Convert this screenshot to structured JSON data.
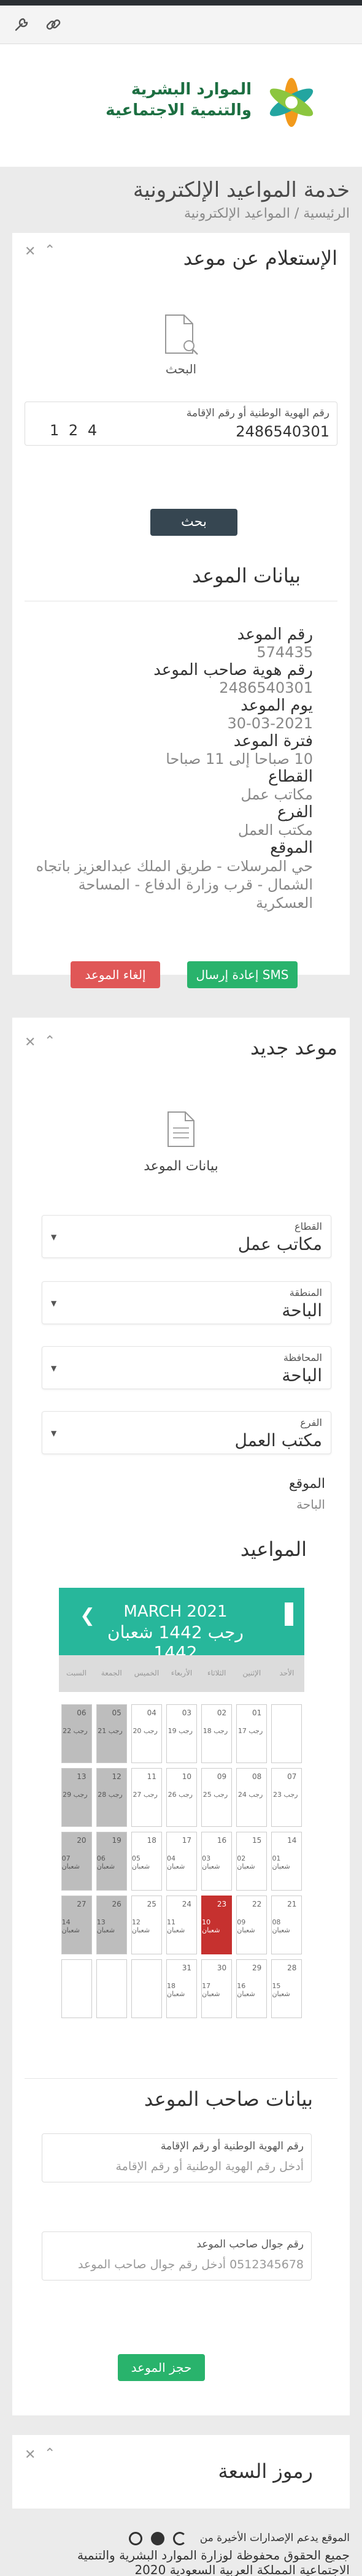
{
  "header": {
    "logo_line1": "الموارد البشرية",
    "logo_line2": "والتنمية الاجتماعية",
    "page_title": "خدمة المواعيد الإلكترونية",
    "breadcrumb": "الرئيسية / المواعيد الإلكترونية"
  },
  "inquiry": {
    "title": "الإستعلام عن موعد",
    "search_label": "البحث",
    "id_field_label": "رقم الهوية الوطنية أو رقم الإقامة",
    "id_field_value": "2486540301",
    "captcha": "4 2 1",
    "search_button": "بحث"
  },
  "appointment": {
    "title": "بيانات الموعد",
    "rows": [
      {
        "label": "رقم الموعد",
        "value": "574435"
      },
      {
        "label": "رقم هوية صاحب الموعد",
        "value": "2486540301"
      },
      {
        "label": "يوم الموعد",
        "value": "30-03-2021"
      },
      {
        "label": "فترة الموعد",
        "value": "10 صباحا إلى 11 صباحا"
      },
      {
        "label": "القطاع",
        "value": "مكاتب عمل"
      },
      {
        "label": "الفرع",
        "value": "مكتب العمل"
      },
      {
        "label": "الموقع",
        "value": "حي المرسلات - طريق الملك عبدالعزيز باتجاه الشمال - قرب وزارة الدفاع - المساحة العسكرية"
      }
    ],
    "cancel_button": "إلغاء الموعد",
    "resend_button": "إعادة إرسال SMS"
  },
  "new_appointment": {
    "title": "موعد جديد",
    "section_label": "بيانات الموعد",
    "selects": [
      {
        "label": "القطاع",
        "value": "مكاتب عمل"
      },
      {
        "label": "المنطقة",
        "value": "الباحة"
      },
      {
        "label": "المحافظة",
        "value": "الباحة"
      },
      {
        "label": "الفرع",
        "value": "مكتب العمل"
      }
    ],
    "location_label": "الموقع",
    "location_value": "الباحة",
    "schedule_title": "المواعيد"
  },
  "calendar": {
    "month_gregorian": "MARCH 2021",
    "month_hijri": "رجب 1442 شعبان 1442",
    "prev_symbol": "❮",
    "days_of_week": [
      "الأحد",
      "الإثنين",
      "الثلاثاء",
      "الأربعاء",
      "الخميس",
      "الجمعة",
      "السبت"
    ],
    "weeks": [
      [
        {
          "g": "",
          "h": "",
          "s": "empty"
        },
        {
          "g": "01",
          "h": "17 رجب",
          "s": "n"
        },
        {
          "g": "02",
          "h": "18 رجب",
          "s": "n"
        },
        {
          "g": "03",
          "h": "19 رجب",
          "s": "n"
        },
        {
          "g": "04",
          "h": "20 رجب",
          "s": "n"
        },
        {
          "g": "05",
          "h": "21 رجب",
          "s": "grey"
        },
        {
          "g": "06",
          "h": "22 رجب",
          "s": "grey"
        }
      ],
      [
        {
          "g": "07",
          "h": "23 رجب",
          "s": "n"
        },
        {
          "g": "08",
          "h": "24 رجب",
          "s": "n"
        },
        {
          "g": "09",
          "h": "25 رجب",
          "s": "n"
        },
        {
          "g": "10",
          "h": "26 رجب",
          "s": "n"
        },
        {
          "g": "11",
          "h": "27 رجب",
          "s": "n"
        },
        {
          "g": "12",
          "h": "28 رجب",
          "s": "grey"
        },
        {
          "g": "13",
          "h": "29 رجب",
          "s": "grey"
        }
      ],
      [
        {
          "g": "14",
          "h": "01 شعبان",
          "s": "n"
        },
        {
          "g": "15",
          "h": "02 شعبان",
          "s": "n"
        },
        {
          "g": "16",
          "h": "03 شعبان",
          "s": "n"
        },
        {
          "g": "17",
          "h": "04 شعبان",
          "s": "n"
        },
        {
          "g": "18",
          "h": "05 شعبان",
          "s": "n"
        },
        {
          "g": "19",
          "h": "06 شعبان",
          "s": "grey"
        },
        {
          "g": "20",
          "h": "07 شعبان",
          "s": "grey"
        }
      ],
      [
        {
          "g": "21",
          "h": "08 شعبان",
          "s": "n"
        },
        {
          "g": "22",
          "h": "09 شعبان",
          "s": "n"
        },
        {
          "g": "23",
          "h": "10 شعبان",
          "s": "sel"
        },
        {
          "g": "24",
          "h": "11 شعبان",
          "s": "n"
        },
        {
          "g": "25",
          "h": "12 شعبان",
          "s": "n"
        },
        {
          "g": "26",
          "h": "13 شعبان",
          "s": "grey"
        },
        {
          "g": "27",
          "h": "14 شعبان",
          "s": "grey"
        }
      ],
      [
        {
          "g": "28",
          "h": "15 شعبان",
          "s": "n"
        },
        {
          "g": "29",
          "h": "16 شعبان",
          "s": "n"
        },
        {
          "g": "30",
          "h": "17 شعبان",
          "s": "n"
        },
        {
          "g": "31",
          "h": "18 شعبان",
          "s": "n"
        },
        {
          "g": "",
          "h": "",
          "s": "empty"
        },
        {
          "g": "",
          "h": "",
          "s": "empty"
        },
        {
          "g": "",
          "h": "",
          "s": "empty"
        }
      ]
    ]
  },
  "owner": {
    "title": "بيانات صاحب الموعد",
    "id_label": "رقم الهوية الوطنية أو رقم الإقامة",
    "id_placeholder": "أدخل رقم الهوية الوطنية أو رقم الإقامة",
    "phone_label": "رقم جوال صاحب الموعد",
    "phone_placeholder": "0512345678 أدخل رقم جوال صاحب الموعد",
    "book_button": "حجز الموعد"
  },
  "qr": {
    "title": "رموز السعة"
  },
  "footer": {
    "line1": "الموقع يدعم الإصدارات الأخيرة من",
    "line2": "جميع الحقوق محفوظة لوزارة الموارد البشرية والتنمية",
    "line3": "الاجتماعية المملكة العربية السعودية 2020"
  },
  "colors": {
    "primary_green": "#27b79b",
    "danger": "#e05757",
    "success": "#29b36c",
    "dark": "#364651",
    "selected_day": "#c6312f"
  }
}
